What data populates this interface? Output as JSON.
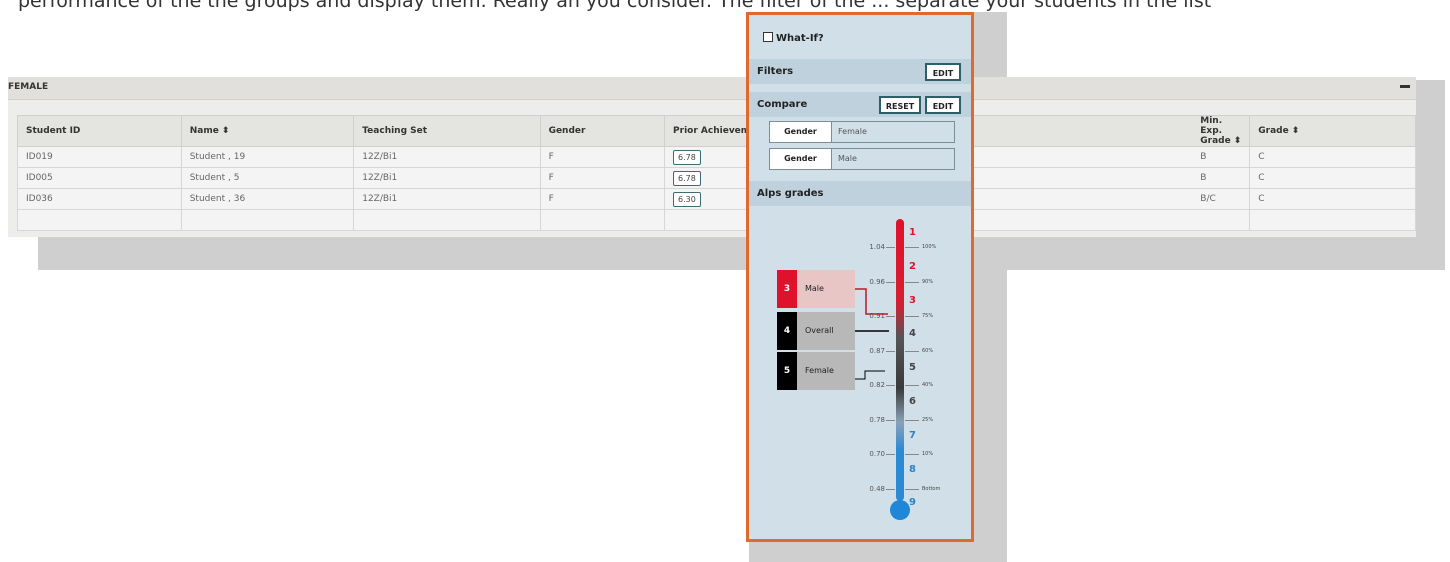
{
  "top_text": "performance of the the groups and display them. Really an you consider. The filter of the ... separate your students in the list",
  "panel": {
    "title": "FEMALE"
  },
  "table": {
    "headers": [
      "Student ID",
      "Name",
      "Teaching Set",
      "Gender",
      "Prior Achieveme",
      "Min. Exp. Grade",
      "Grade"
    ],
    "sortable": [
      false,
      true,
      false,
      false,
      false,
      true,
      true
    ],
    "rows": [
      {
        "id": "ID019",
        "name": "Student , 19",
        "set": "12Z/Bi1",
        "gender": "F",
        "pa": "6.78",
        "min": "B",
        "grade": "C"
      },
      {
        "id": "ID005",
        "name": "Student , 5",
        "set": "12Z/Bi1",
        "gender": "F",
        "pa": "6.78",
        "min": "B",
        "grade": "C"
      },
      {
        "id": "ID036",
        "name": "Student , 36",
        "set": "12Z/Bi1",
        "gender": "F",
        "pa": "6.30",
        "min": "B/C",
        "grade": "C"
      }
    ]
  },
  "side": {
    "what_if": "What-If?",
    "filters": "Filters",
    "filters_edit": "EDIT",
    "compare": "Compare",
    "reset": "RESET",
    "compare_edit": "EDIT",
    "compare_items": [
      {
        "key": "Gender",
        "value": "Female"
      },
      {
        "key": "Gender",
        "value": "Male"
      }
    ],
    "alps_title": "Alps grades"
  },
  "alps": {
    "grades": [
      "1",
      "2",
      "3",
      "4",
      "5",
      "6",
      "7",
      "8",
      "9"
    ],
    "grade_colors": [
      "#e0112b",
      "#e0112b",
      "#e0112b",
      "#444444",
      "#444444",
      "#444444",
      "#2a82c8",
      "#2a82c8",
      "#2a82c8"
    ],
    "values": [
      "1.04",
      "0.96",
      "0.91",
      "0.87",
      "0.82",
      "0.78",
      "0.70",
      "0.48"
    ],
    "percentiles": [
      "100%",
      "90%",
      "75%",
      "60%",
      "40%",
      "25%",
      "10%",
      "Bottom"
    ],
    "labels": [
      {
        "num": "3",
        "text": "Male",
        "num_color": "#e0112b",
        "bg": "#e8c6c6",
        "line_color": "#c81422"
      },
      {
        "num": "4",
        "text": "Overall",
        "num_color": "#000000",
        "bg": "#b8b8b8",
        "line_color": "#000000"
      },
      {
        "num": "5",
        "text": "Female",
        "num_color": "#000000",
        "bg": "#b8b8b8",
        "line_color": "#000000"
      }
    ]
  }
}
